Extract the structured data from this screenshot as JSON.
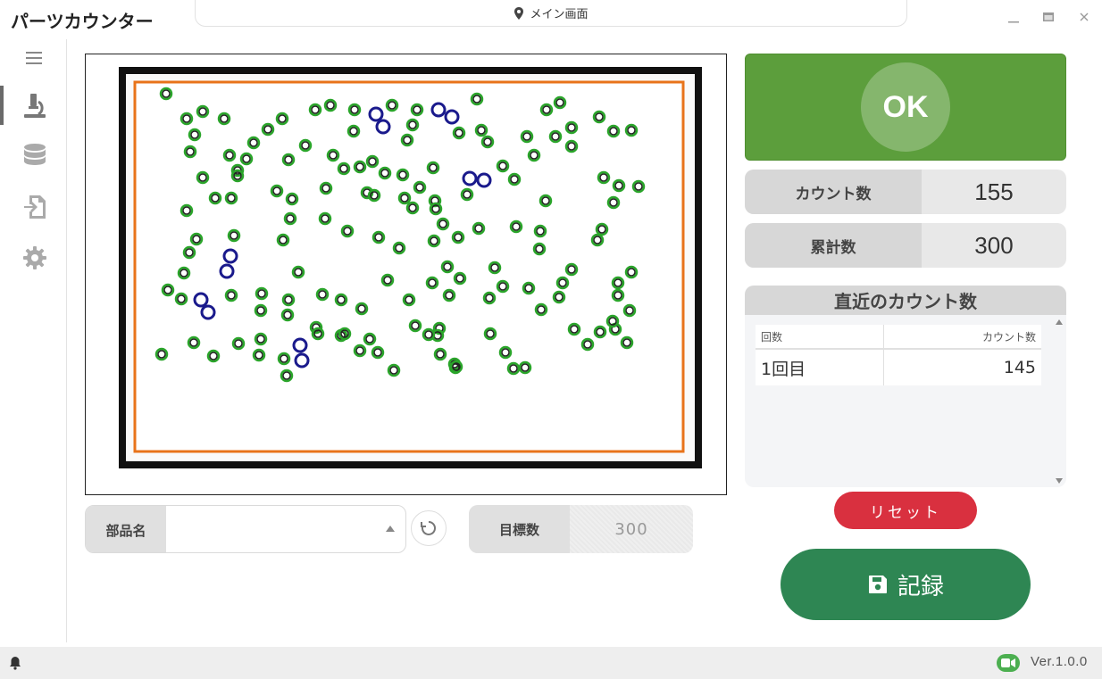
{
  "app": {
    "title": "パーツカウンター",
    "screen_name": "メイン画面"
  },
  "window_controls": {
    "minimize": "–",
    "maximize": "▢",
    "close": "✕"
  },
  "sidebar": {
    "items": [
      {
        "name": "menu-icon",
        "active": false
      },
      {
        "name": "microscope-icon",
        "active": true
      },
      {
        "name": "database-icon",
        "active": false
      },
      {
        "name": "export-file-icon",
        "active": false
      },
      {
        "name": "settings-gear-icon",
        "active": false
      }
    ]
  },
  "part": {
    "label": "部品名",
    "value": ""
  },
  "target": {
    "label": "目標数",
    "value": "300"
  },
  "result": {
    "status": "OK",
    "status_color": "#5c9e3c"
  },
  "stats": {
    "count_label": "カウント数",
    "count_value": "155",
    "total_label": "累計数",
    "total_value": "300"
  },
  "recent": {
    "title": "直近のカウント数",
    "headers": [
      "回数",
      "カウント数"
    ],
    "rows": [
      {
        "round": "1回目",
        "count": "145"
      }
    ]
  },
  "buttons": {
    "reset": "リセット",
    "record": "記録"
  },
  "status_bar": {
    "version": "Ver.1.0.0"
  },
  "colors": {
    "detected_ok": "#2aa52a",
    "detected_multi": "#1a1a8c",
    "frame_border": "#e8731a",
    "reset": "#d9303f",
    "record": "#2e8653"
  }
}
